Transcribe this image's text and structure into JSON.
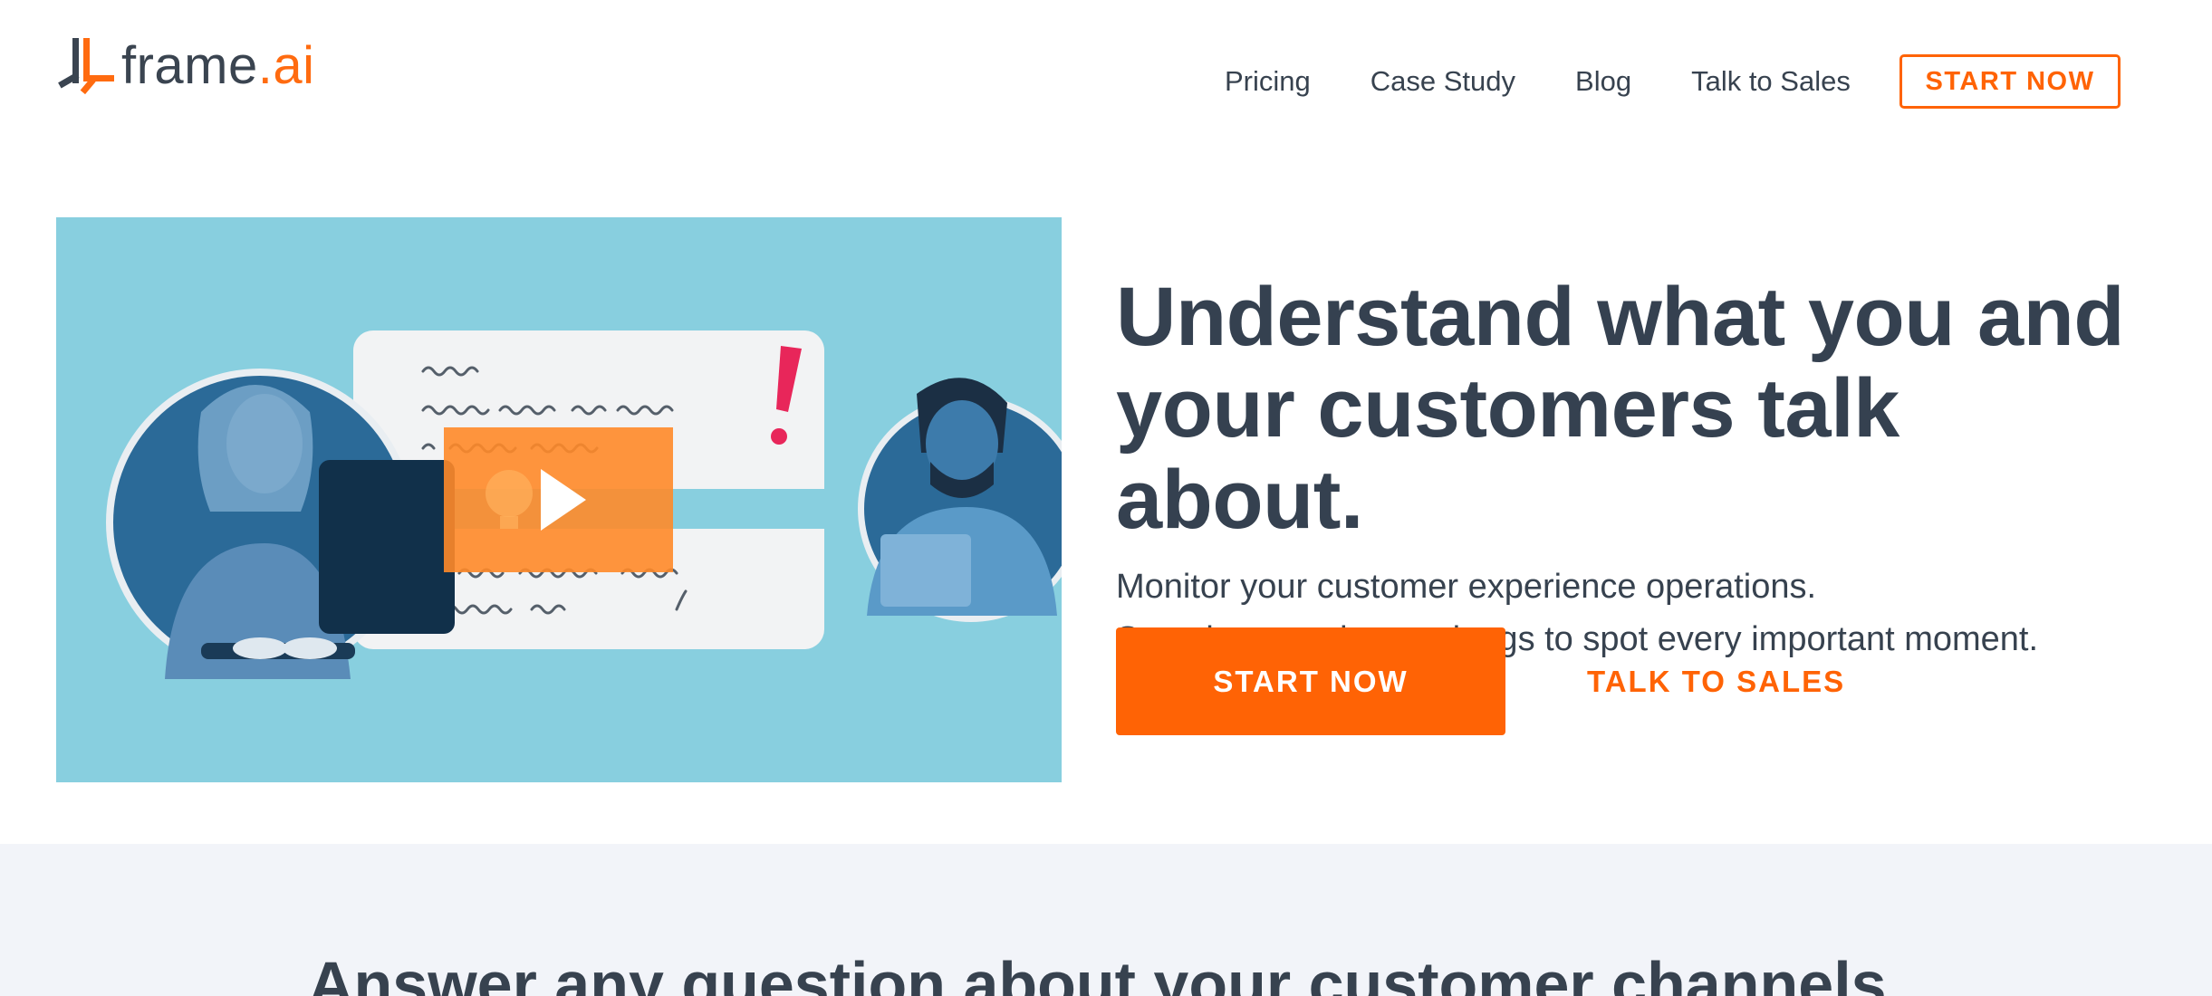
{
  "logo": {
    "name": "frame",
    "suffix": ".ai",
    "icon": "frame-logo-icon"
  },
  "nav": {
    "links": [
      "Pricing",
      "Case Study",
      "Blog",
      "Talk to Sales"
    ],
    "cta": "START NOW"
  },
  "hero": {
    "headline_line1": "Understand what you and",
    "headline_line2": "your customers talk about.",
    "sub_line1": "Monitor your customer experience operations.",
    "sub_line2": "Search transcripts and tags to spot every important moment.",
    "primary_cta": "START NOW",
    "secondary_cta": "TALK TO SALES",
    "video": {
      "icon": "play-icon",
      "background": "#88cfdf",
      "overlay": "#ff8a29"
    }
  },
  "section2": {
    "title": "Answer any question about your customer channels."
  },
  "colors": {
    "accent": "#ff6305",
    "text": "#37424f",
    "section_bg": "#f2f4f9"
  }
}
